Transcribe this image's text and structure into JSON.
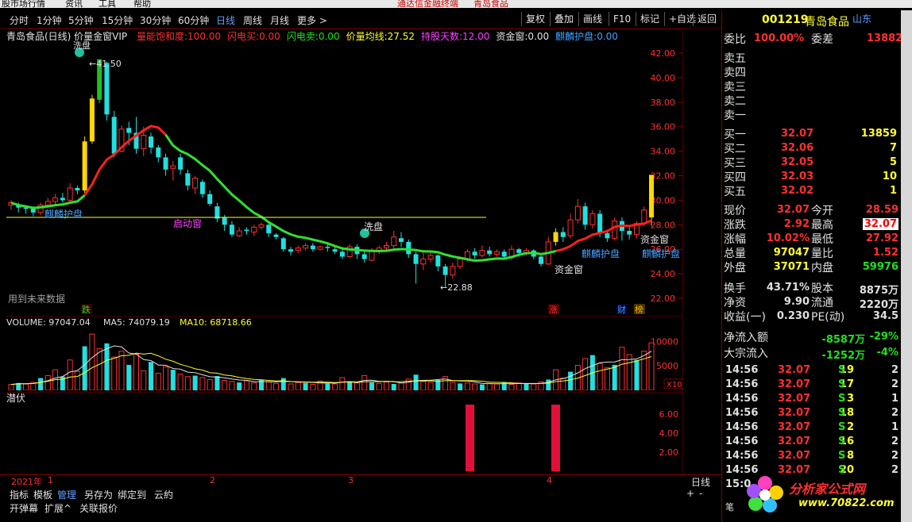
{
  "top_menu": [
    "股市场行情",
    "资讯",
    "工具",
    "帮助",
    "通达信金融终端",
    "青岛食品"
  ],
  "toolbar": {
    "periods": [
      "分时",
      "1分钟",
      "5分钟",
      "15分钟",
      "30分钟",
      "60分钟",
      "日线",
      "周线",
      "月线",
      "更多 >"
    ],
    "active": "日线",
    "buttons": [
      "复权",
      "叠加",
      "画线",
      "F10",
      "标记",
      "+自选",
      "返回"
    ]
  },
  "header": {
    "title": "青岛食品(日线) 价量金窗VIP",
    "items": [
      {
        "label": "量能饱和度:",
        "value": "100.00",
        "color": "#ff3030"
      },
      {
        "label": "闪电买:",
        "value": "0.00",
        "color": "#ff3030"
      },
      {
        "label": "闪电卖:",
        "value": "0.00",
        "color": "#20e020"
      },
      {
        "label": "价量均线:",
        "value": "27.52",
        "color": "#ffff30"
      },
      {
        "label": "持股天数:",
        "value": "12.00",
        "color": "#ff40ff"
      },
      {
        "label": "资金窗:",
        "value": "0.00",
        "color": "#e0e0e0"
      },
      {
        "label": "麒麟护盘:",
        "value": "0.00",
        "color": "#40a0ff"
      }
    ]
  },
  "chart_labels": {
    "high_marker": "41.50",
    "low_marker": "22.88",
    "buy_mark": "洗盘",
    "buy_mark_top": "洗盘",
    "qilin": "麒麟护盘",
    "zijin": "资金窗",
    "qidong": "启动窗",
    "future": "用到未来数据",
    "die": "跌",
    "zhang": "涨",
    "cai": "财",
    "tan": "榜"
  },
  "y_ticks": [
    "42.00",
    "40.00",
    "38.00",
    "36.00",
    "34.00",
    "32.00",
    "30.00",
    "28.00",
    "26.00",
    "24.00",
    "22.00"
  ],
  "volume": {
    "label": "VOLUME:",
    "value": "97047.04",
    "ma5_label": "MA5:",
    "ma5": "74079.19",
    "ma10_label": "MA10:",
    "ma10": "68718.66",
    "ticks": [
      "10000",
      "5000"
    ],
    "unit": "X10"
  },
  "indicator": {
    "label": "潜伏",
    "ticks": [
      "6.00",
      "4.00",
      "2.00"
    ]
  },
  "x_axis": {
    "labels": [
      "2021年",
      "1",
      "2",
      "3",
      "4"
    ],
    "period": "日线"
  },
  "bottom_tabs": [
    "指标",
    "模板",
    "管理",
    "另存为",
    "绑定到",
    "云約"
  ],
  "bottom_tabs2": [
    "开弹幕",
    "扩展^",
    "关联报价"
  ],
  "quote": {
    "code": "001219",
    "name": "青岛食品",
    "region": "山东",
    "weibi_label": "委比",
    "weibi": "100.00%",
    "weicha_label": "委差",
    "weicha": "13882",
    "sells": [
      {
        "label": "卖五"
      },
      {
        "label": "卖四"
      },
      {
        "label": "卖三"
      },
      {
        "label": "卖二"
      },
      {
        "label": "卖一"
      }
    ],
    "buys": [
      {
        "label": "买一",
        "price": "32.07",
        "vol": "13859"
      },
      {
        "label": "买二",
        "price": "32.06",
        "vol": "7"
      },
      {
        "label": "买三",
        "price": "32.05",
        "vol": "5"
      },
      {
        "label": "买四",
        "price": "32.03",
        "vol": "10"
      },
      {
        "label": "买五",
        "price": "32.02",
        "vol": "1"
      }
    ],
    "stats": [
      [
        "现价",
        "32.07",
        "今开",
        "28.59"
      ],
      [
        "涨跌",
        "2.92",
        "最高",
        "32.07"
      ],
      [
        "涨幅",
        "10.02%",
        "最低",
        "27.92"
      ],
      [
        "总量",
        "97047",
        "量比",
        "1.52"
      ],
      [
        "外盘",
        "37071",
        "内盘",
        "59976"
      ]
    ],
    "stats2": [
      [
        "换手",
        "43.71%",
        "股本",
        "8875万"
      ],
      [
        "净资",
        "9.90",
        "流通",
        "2220万"
      ],
      [
        "收益(一)",
        "0.230",
        "PE(动)",
        "34.5"
      ]
    ],
    "flows": [
      {
        "label": "净流入额",
        "value": "-8587万",
        "pct": "-29%"
      },
      {
        "label": "大宗流入",
        "value": "-1252万",
        "pct": "-4%"
      }
    ],
    "ticks": [
      {
        "time": "14:56",
        "price": "32.07",
        "vol": "19",
        "side": "S",
        "n": "2"
      },
      {
        "time": "14:56",
        "price": "32.07",
        "vol": "17",
        "side": "S",
        "n": "2"
      },
      {
        "time": "14:56",
        "price": "32.07",
        "vol": "3",
        "side": "S",
        "n": "1"
      },
      {
        "time": "14:56",
        "price": "32.07",
        "vol": "18",
        "side": "S",
        "n": "2"
      },
      {
        "time": "14:56",
        "price": "32.07",
        "vol": "2",
        "side": "S",
        "n": "1"
      },
      {
        "time": "14:56",
        "price": "32.07",
        "vol": "16",
        "side": "S",
        "n": "2"
      },
      {
        "time": "14:56",
        "price": "32.07",
        "vol": "8",
        "side": "S",
        "n": "2"
      },
      {
        "time": "14:56",
        "price": "32.07",
        "vol": "20",
        "side": "S",
        "n": "2"
      },
      {
        "time": "15:0",
        "price": "",
        "vol": "",
        "side": "",
        "n": ""
      }
    ],
    "logo_text": "分析家公式网",
    "logo_url": "www.70822.com"
  },
  "colors": {
    "up": "#ff3030",
    "down": "#20e0e0",
    "gold": "#ffd800",
    "ma_green": "#30e030",
    "ma_red": "#ff2020"
  }
}
